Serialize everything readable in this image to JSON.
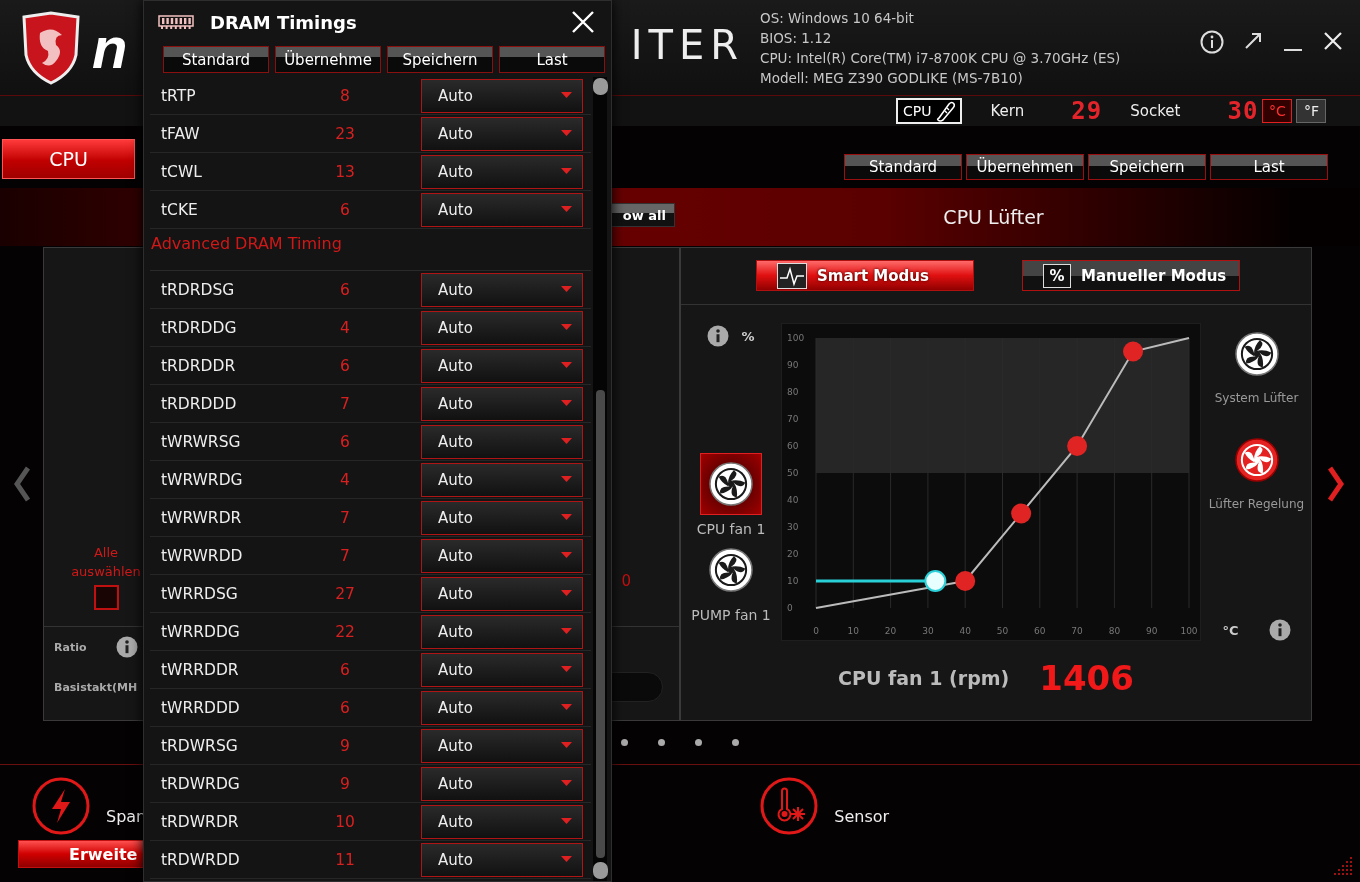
{
  "header": {
    "logo_left": "n",
    "logo_right": "ITER",
    "system_info": [
      "OS: Windows 10 64-bit",
      "BIOS: 1.12",
      "CPU: Intel(R) Core(TM) i7-8700K CPU @ 3.70GHz (ES)",
      "Modell: MEG Z390 GODLIKE (MS-7B10)"
    ]
  },
  "temperature_bar": {
    "source": "CPU",
    "readings": [
      {
        "label": "Kern",
        "value": "29"
      },
      {
        "label": "Socket",
        "value": "30"
      }
    ],
    "units": [
      {
        "label": "°C",
        "selected": true
      },
      {
        "label": "°F",
        "selected": false
      }
    ]
  },
  "tabs": [
    {
      "label": "CPU",
      "selected": true
    }
  ],
  "profile_buttons": [
    "Standard",
    "Übernehmen",
    "Speichern",
    "Last"
  ],
  "show_all_button": "ow all",
  "section_title": "CPU Lüfter",
  "navigation": {
    "prev_enabled": false,
    "next_enabled": true
  },
  "left_panel": {
    "select_all_label": "Alle auswählen",
    "select_all_checked": false,
    "value": "0",
    "fields": [
      "Ratio",
      "Basistakt(MH"
    ]
  },
  "fan_panel": {
    "modes": [
      {
        "label": "Smart Modus",
        "selected": true
      },
      {
        "label": "Manueller Modus",
        "badge": "%",
        "selected": false
      }
    ],
    "y_unit": "%",
    "x_unit": "°C",
    "fans_left": [
      {
        "label": "CPU fan 1",
        "selected": true
      },
      {
        "label": "PUMP fan 1",
        "selected": false
      }
    ],
    "fans_right": [
      {
        "label": "System Lüfter",
        "selected": false
      },
      {
        "label": "Lüfter Regelung",
        "selected": true
      }
    ],
    "chart_data": {
      "type": "line",
      "x": [
        0,
        32,
        40,
        55,
        70,
        85,
        100
      ],
      "series": [
        {
          "color": "#bbbbbb",
          "values": [
            0,
            8,
            10,
            35,
            60,
            95,
            100
          ]
        },
        {
          "color": "#2ad0d8",
          "values": [
            10,
            10,
            null,
            null,
            null,
            null,
            null
          ]
        }
      ],
      "xlim": [
        0,
        100
      ],
      "ylim": [
        0,
        100
      ],
      "xticks": [
        0,
        10,
        20,
        30,
        40,
        50,
        60,
        70,
        80,
        90,
        100
      ],
      "yticks": [
        0,
        10,
        20,
        30,
        40,
        50,
        60,
        70,
        80,
        90,
        100
      ],
      "grid": true,
      "bands": [
        {
          "axis": "y",
          "from": 50,
          "to": 100,
          "color": "#262626"
        }
      ]
    },
    "rpm_label": "CPU fan 1 (rpm)",
    "rpm_value": "1406"
  },
  "bottom": {
    "items": [
      {
        "label": "Span",
        "kind": "voltage"
      },
      {
        "label": "Sensor",
        "kind": "sensor"
      }
    ],
    "advanced_button": "Erweite"
  },
  "dialog": {
    "title": "DRAM Timings",
    "buttons": [
      "Standard",
      "Übernehme",
      "Speichern",
      "Last"
    ],
    "sections": [
      {
        "rows": [
          {
            "name": "tRTP",
            "value": "8",
            "setting": "Auto"
          },
          {
            "name": "tFAW",
            "value": "23",
            "setting": "Auto"
          },
          {
            "name": "tCWL",
            "value": "13",
            "setting": "Auto"
          },
          {
            "name": "tCKE",
            "value": "6",
            "setting": "Auto"
          }
        ]
      },
      {
        "title": "Advanced DRAM Timing",
        "rows": [
          {
            "name": "tRDRDSG",
            "value": "6",
            "setting": "Auto"
          },
          {
            "name": "tRDRDDG",
            "value": "4",
            "setting": "Auto"
          },
          {
            "name": "tRDRDDR",
            "value": "6",
            "setting": "Auto"
          },
          {
            "name": "tRDRDDD",
            "value": "7",
            "setting": "Auto"
          },
          {
            "name": "tWRWRSG",
            "value": "6",
            "setting": "Auto"
          },
          {
            "name": "tWRWRDG",
            "value": "4",
            "setting": "Auto"
          },
          {
            "name": "tWRWRDR",
            "value": "7",
            "setting": "Auto"
          },
          {
            "name": "tWRWRDD",
            "value": "7",
            "setting": "Auto"
          },
          {
            "name": "tWRRDSG",
            "value": "27",
            "setting": "Auto"
          },
          {
            "name": "tWRRDDG",
            "value": "22",
            "setting": "Auto"
          },
          {
            "name": "tWRRDDR",
            "value": "6",
            "setting": "Auto"
          },
          {
            "name": "tWRRDDD",
            "value": "6",
            "setting": "Auto"
          },
          {
            "name": "tRDWRSG",
            "value": "9",
            "setting": "Auto"
          },
          {
            "name": "tRDWRDG",
            "value": "9",
            "setting": "Auto"
          },
          {
            "name": "tRDWRDR",
            "value": "10",
            "setting": "Auto"
          },
          {
            "name": "tRDWRDD",
            "value": "11",
            "setting": "Auto"
          }
        ]
      }
    ]
  }
}
